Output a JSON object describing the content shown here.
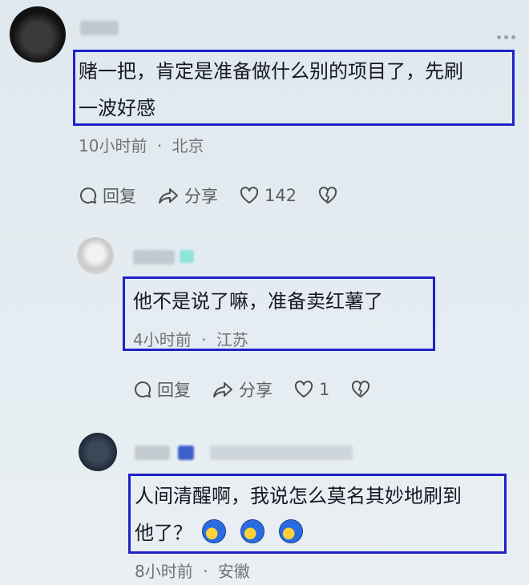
{
  "comments": [
    {
      "text_line1": "赌一把，肯定是准备做什么别的项目了，先刷",
      "text_line2": "一波好感",
      "time": "10小时前",
      "location": "北京",
      "reply_label": "回复",
      "share_label": "分享",
      "likes": "142"
    }
  ],
  "replies": [
    {
      "text": "他不是说了嘛，准备卖红薯了",
      "time": "4小时前",
      "location": "江苏",
      "reply_label": "回复",
      "share_label": "分享",
      "likes": "1"
    },
    {
      "text_line1": "人间清醒啊，我说怎么莫名其妙地刷到",
      "text_line2": "他了？",
      "time": "8小时前",
      "location": "安徽"
    }
  ],
  "separator": "·",
  "colors": {
    "highlight_border": "#1f22c8",
    "meta_text": "#6f7378",
    "background": "#e4ecf1"
  },
  "icons": [
    "reply-bubble-icon",
    "share-arrow-icon",
    "heart-icon",
    "broken-heart-icon",
    "more-dots-icon"
  ]
}
